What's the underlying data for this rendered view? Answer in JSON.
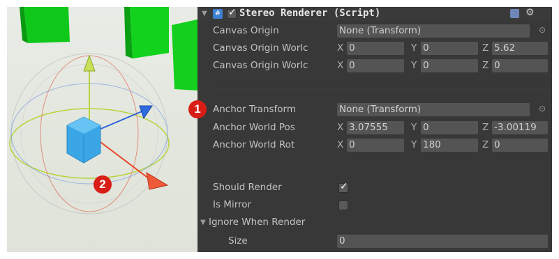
{
  "scene": {
    "badge_label": "2",
    "colors": {
      "cube": "#3aa6e6",
      "x_axis": "#e8472a",
      "y_axis": "#b6d43a",
      "z_axis": "#2b63d6",
      "pillar": "#10c81a"
    },
    "icons": [
      "translate-cone-icon-y",
      "translate-cone-icon-x",
      "translate-cone-icon-z",
      "selected-cube-icon"
    ]
  },
  "inspector": {
    "header": {
      "title": "Stereo Renderer (Script)",
      "enabled": true,
      "icons": [
        "script-icon",
        "help-book-icon",
        "settings-gear-icon"
      ]
    },
    "badge_label": "1",
    "fields": {
      "canvas_origin": {
        "label": "Canvas Origin",
        "value": "None (Transform)"
      },
      "canvas_origin_world_pos": {
        "label": "Canvas Origin Worlc",
        "x": "0",
        "y": "0",
        "z": "5.62"
      },
      "canvas_origin_world_rot": {
        "label": "Canvas Origin Worlc",
        "x": "0",
        "y": "0",
        "z": "0"
      },
      "anchor_transform": {
        "label": "Anchor Transform",
        "value": "None (Transform)"
      },
      "anchor_world_pos": {
        "label": "Anchor World Pos",
        "x": "3.07555",
        "y": "0",
        "z": "-3.00119"
      },
      "anchor_world_rot": {
        "label": "Anchor World Rot",
        "x": "0",
        "y": "180",
        "z": "0"
      },
      "should_render": {
        "label": "Should Render",
        "checked": true
      },
      "is_mirror": {
        "label": "Is Mirror",
        "checked": false
      },
      "ignore_when_render": {
        "label": "Ignore When Render"
      },
      "size": {
        "label": "Size",
        "value": "0"
      }
    },
    "axis_labels": {
      "x": "X",
      "y": "Y",
      "z": "Z"
    }
  }
}
